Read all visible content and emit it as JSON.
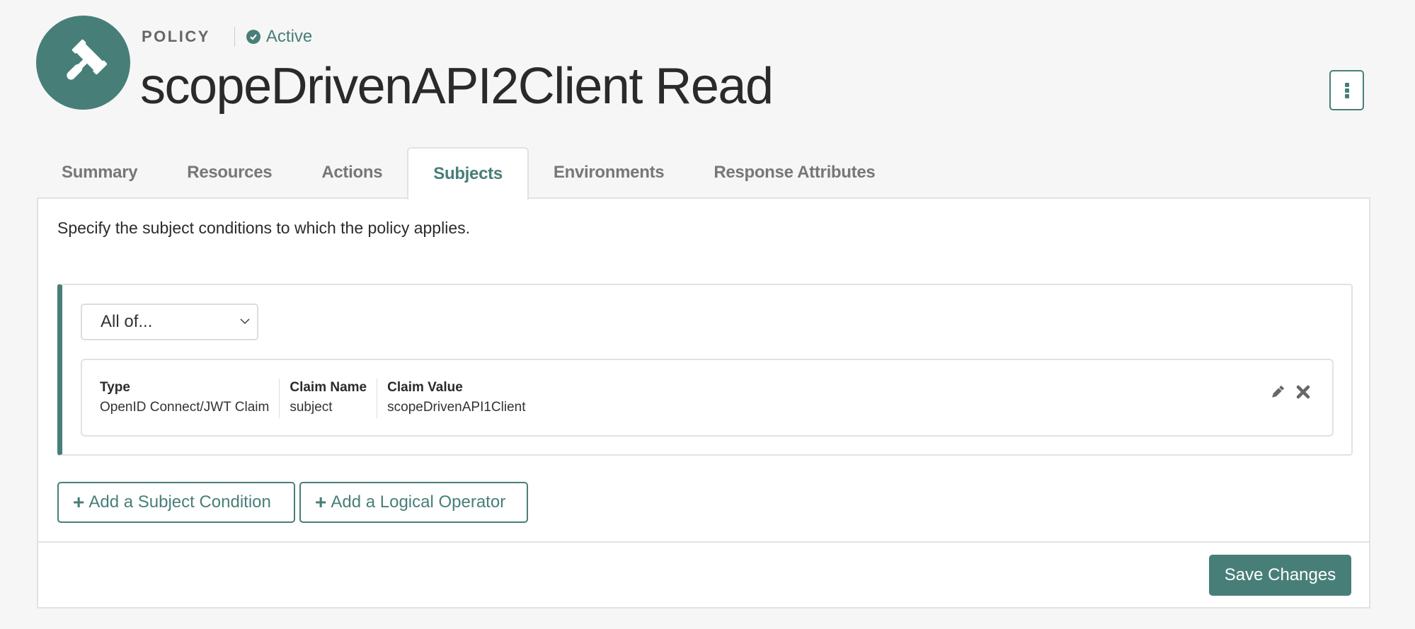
{
  "header": {
    "type_label": "POLICY",
    "status": "Active",
    "title": "scopeDrivenAPI2Client Read",
    "logo_icon": "gavel-icon",
    "status_icon": "check-circle-icon",
    "more_icon": "kebab-menu-icon"
  },
  "tabs": [
    {
      "label": "Summary",
      "active": false
    },
    {
      "label": "Resources",
      "active": false
    },
    {
      "label": "Actions",
      "active": false
    },
    {
      "label": "Subjects",
      "active": true
    },
    {
      "label": "Environments",
      "active": false
    },
    {
      "label": "Response Attributes",
      "active": false
    }
  ],
  "subjects": {
    "intro": "Specify the subject conditions to which the policy applies.",
    "operator": {
      "selected": "All of..."
    },
    "conditions": [
      {
        "columns": [
          {
            "label": "Type",
            "value": "OpenID Connect/JWT Claim"
          },
          {
            "label": "Claim Name",
            "value": "subject"
          },
          {
            "label": "Claim Value",
            "value": "scopeDrivenAPI1Client"
          }
        ],
        "actions": [
          "pencil-icon",
          "close-icon"
        ]
      }
    ],
    "add_condition_label": "Add a Subject Condition",
    "add_operator_label": "Add a Logical Operator",
    "plus_glyph": "+"
  },
  "footer": {
    "save_label": "Save Changes"
  },
  "colors": {
    "accent": "#477f78",
    "background": "#f6f6f6",
    "border": "#e2e2e2"
  }
}
